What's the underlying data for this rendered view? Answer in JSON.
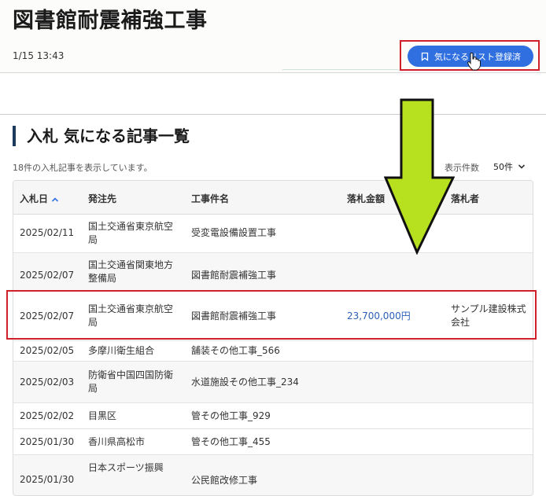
{
  "header": {
    "title": "図書館耐震補強工事",
    "timestamp": "1/15 13:43",
    "favorite_button_label": "気になるリスト登録済"
  },
  "section": {
    "heading": "入札 気になる記事一覧",
    "result_count": "18件の入札記事を表示しています。",
    "per_page_label": "表示件数",
    "per_page_value": "50件"
  },
  "table": {
    "columns": [
      "入札日",
      "発注先",
      "工事件名",
      "落札金額",
      "落札者"
    ],
    "rows": [
      [
        "2025/02/11",
        "国土交通省東京航空局",
        "受変電設備設置工事",
        "",
        ""
      ],
      [
        "2025/02/07",
        "国土交通省関東地方整備局",
        "図書館耐震補強工事",
        "",
        ""
      ],
      [
        "2025/02/07",
        "国土交通省東京航空局",
        "図書館耐震補強工事",
        "23,700,000円",
        "サンプル建設株式会社"
      ],
      [
        "2025/02/05",
        "多摩川衛生組合",
        "舗装その他工事_566",
        "",
        ""
      ],
      [
        "2025/02/03",
        "防衛省中国四国防衛局",
        "水道施設その他工事_234",
        "",
        ""
      ],
      [
        "2025/02/02",
        "目黒区",
        "管その他工事_929",
        "",
        ""
      ],
      [
        "2025/01/30",
        "香川県高松市",
        "管その他工事_455",
        "",
        ""
      ],
      [
        "2025/01/30",
        "日本スポーツ振興",
        "公民館改修工事",
        "",
        ""
      ]
    ]
  },
  "icons": {
    "bookmark": "bookmark-icon",
    "sort": "chevron-up-icon",
    "dropdown": "chevron-down-icon",
    "cursor": "hand-cursor-icon",
    "annotation": "down-arrow-icon"
  },
  "colors": {
    "button_blue": "#2f6fe0",
    "highlight_red": "#d0202a",
    "arrow_green": "#b7e11f",
    "amount_blue": "#2c5fb8",
    "heading_bar": "#1f3a5f"
  }
}
